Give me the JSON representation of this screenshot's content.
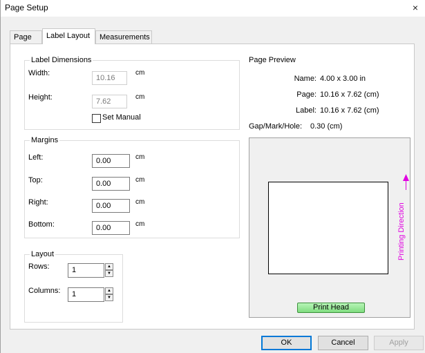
{
  "window": {
    "title": "Page Setup",
    "close_glyph": "×"
  },
  "tabs": [
    {
      "label": "Page"
    },
    {
      "label": "Label Layout"
    },
    {
      "label": "Measurements"
    }
  ],
  "label_dimensions": {
    "title": "Label Dimensions",
    "width_label": "Width:",
    "width_value": "10.16",
    "height_label": "Height:",
    "height_value": "7.62",
    "unit": "cm",
    "set_manual_label": "Set Manual",
    "set_manual_checked": false
  },
  "margins": {
    "title": "Margins",
    "left_label": "Left:",
    "left_value": "0.00",
    "top_label": "Top:",
    "top_value": "0.00",
    "right_label": "Right:",
    "right_value": "0.00",
    "bottom_label": "Bottom:",
    "bottom_value": "0.00",
    "unit": "cm"
  },
  "layout": {
    "title": "Layout",
    "rows_label": "Rows:",
    "rows_value": "1",
    "columns_label": "Columns:",
    "columns_value": "1"
  },
  "preview": {
    "title": "Page Preview",
    "name_label": "Name:",
    "name_value": "4.00 x 3.00 in",
    "page_label": "Page:",
    "page_value": "10.16  x  7.62  (cm)",
    "label_label": "Label:",
    "label_value": "10.16  x  7.62  (cm)",
    "gap_label": "Gap/Mark/Hole:",
    "gap_value": "0.30  (cm)",
    "print_head": "Print Head",
    "printing_direction": "Printing Direction",
    "direction_color": "#e000e0"
  },
  "buttons": {
    "ok": "OK",
    "cancel": "Cancel",
    "apply": "Apply"
  },
  "icons": {
    "close": "close-icon",
    "spin_up": "spin-up-icon",
    "spin_down": "spin-down-icon",
    "arrow": "arrow-up-icon"
  }
}
